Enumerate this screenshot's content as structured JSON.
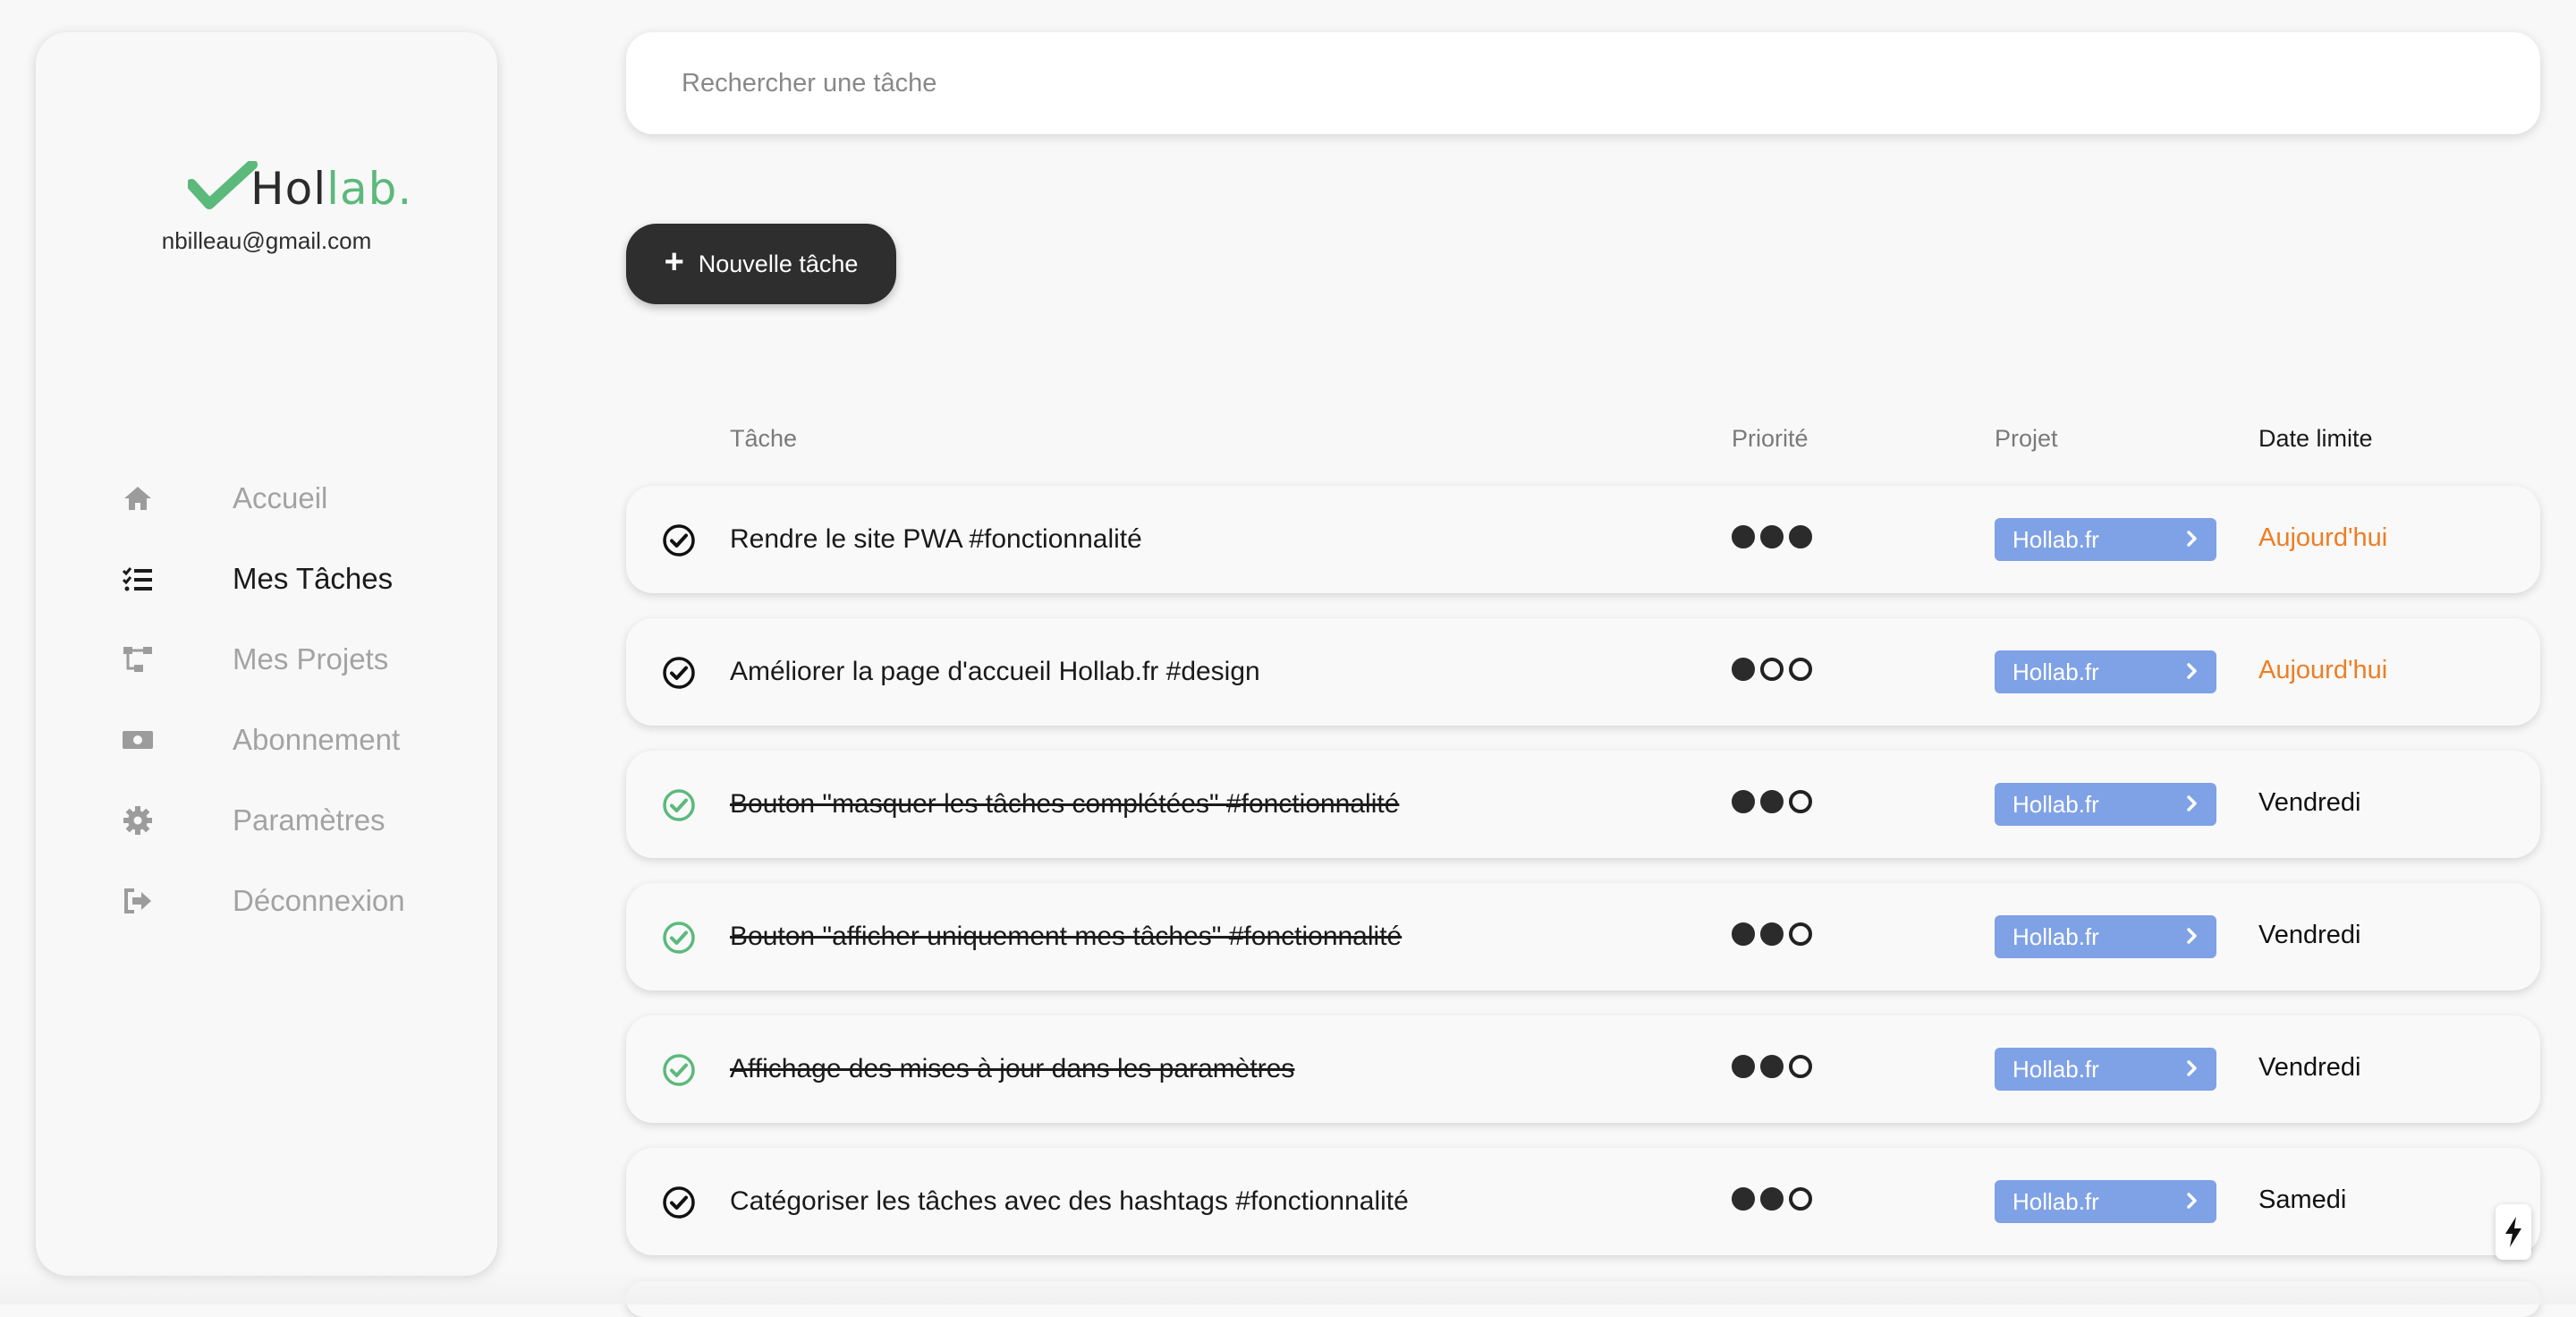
{
  "sidebar": {
    "logo": {
      "text_dark": "Ho",
      "text_o": "",
      "text_green": "lab.",
      "full": "Hollab.",
      "color_green": "#5cb97c"
    },
    "user_email": "nbilleau@gmail.com",
    "nav": [
      {
        "label": "Accueil",
        "icon": "home-icon",
        "active": false
      },
      {
        "label": "Mes Tâches",
        "icon": "task-list-icon",
        "active": true
      },
      {
        "label": "Mes Projets",
        "icon": "project-tree-icon",
        "active": false
      },
      {
        "label": "Abonnement",
        "icon": "money-icon",
        "active": false
      },
      {
        "label": "Paramètres",
        "icon": "gear-icon",
        "active": false
      },
      {
        "label": "Déconnexion",
        "icon": "logout-icon",
        "active": false
      }
    ]
  },
  "search": {
    "placeholder": "Rechercher une tâche",
    "value": ""
  },
  "new_task_button": {
    "label": "Nouvelle tâche"
  },
  "table": {
    "headers": {
      "task": "Tâche",
      "priority": "Priorité",
      "project": "Projet",
      "due": "Date limite"
    },
    "rows": [
      {
        "title": "Rendre le site PWA #fonctionnalité",
        "done": false,
        "priority": 3,
        "project": "Hollab.fr",
        "due": "Aujourd'hui",
        "due_today": true
      },
      {
        "title": "Améliorer la page d'accueil Hollab.fr #design",
        "done": false,
        "priority": 1,
        "project": "Hollab.fr",
        "due": "Aujourd'hui",
        "due_today": true
      },
      {
        "title": "Bouton \"masquer les tâches complétées\" #fonctionnalité",
        "done": true,
        "priority": 2,
        "project": "Hollab.fr",
        "due": "Vendredi",
        "due_today": false
      },
      {
        "title": "Bouton \"afficher uniquement mes tâches\" #fonctionnalité",
        "done": true,
        "priority": 2,
        "project": "Hollab.fr",
        "due": "Vendredi",
        "due_today": false
      },
      {
        "title": "Affichage des mises à jour dans les paramètres",
        "done": true,
        "priority": 2,
        "project": "Hollab.fr",
        "due": "Vendredi",
        "due_today": false
      },
      {
        "title": "Catégoriser les tâches avec des hashtags #fonctionnalité",
        "done": false,
        "priority": 2,
        "project": "Hollab.fr",
        "due": "Samedi",
        "due_today": false
      }
    ]
  },
  "colors": {
    "accent_project": "#7fa1e6",
    "today": "#ef7d22",
    "done_check": "#5cb97c",
    "dark_button": "#2e2e2e"
  }
}
